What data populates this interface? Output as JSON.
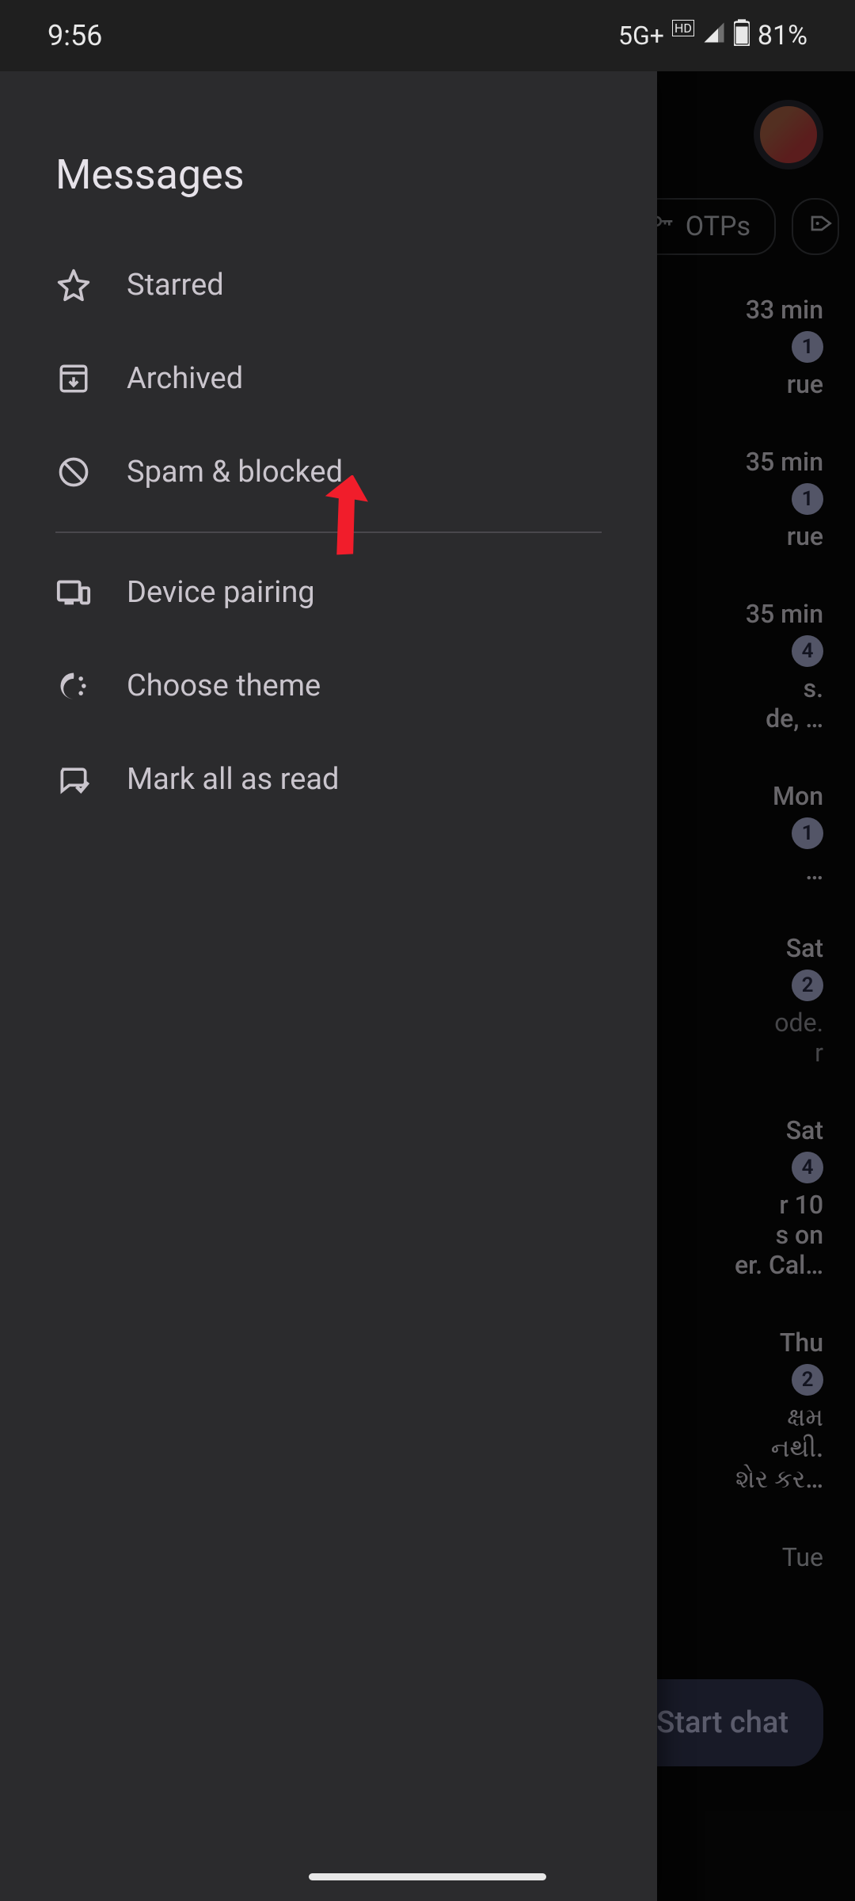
{
  "status_bar": {
    "time": "9:56",
    "network": "5G+",
    "hd": "HD",
    "battery": "81%"
  },
  "drawer": {
    "title": "Messages",
    "items_top": [
      {
        "icon": "star",
        "label": "Starred"
      },
      {
        "icon": "archive",
        "label": "Archived"
      },
      {
        "icon": "blocked",
        "label": "Spam & blocked"
      }
    ],
    "items_bottom": [
      {
        "icon": "devices",
        "label": "Device pairing"
      },
      {
        "icon": "theme",
        "label": "Choose theme"
      },
      {
        "icon": "markread",
        "label": "Mark all as read"
      }
    ]
  },
  "background": {
    "chip_otps": "OTPs",
    "fab_label": "Start chat",
    "conversations": [
      {
        "time": "33 min",
        "badge": "1",
        "snippet": "rue"
      },
      {
        "time": "35 min",
        "badge": "1",
        "snippet": "rue"
      },
      {
        "time": "35 min",
        "badge": "4",
        "snippet": "s.\nde, …"
      },
      {
        "time": "Mon",
        "badge": "1",
        "snippet": "…"
      },
      {
        "time": "Sat",
        "badge": "2",
        "snippet": "ode.\nr"
      },
      {
        "time": "Sat",
        "badge": "4",
        "snippet": "r 10\ns on\ner. Cal…"
      },
      {
        "time": "Thu",
        "badge": "2",
        "snippet": "ક્ષમ\nનથી.\nશેર કર…"
      },
      {
        "time": "Tue",
        "badge": "",
        "snippet": ""
      }
    ]
  }
}
